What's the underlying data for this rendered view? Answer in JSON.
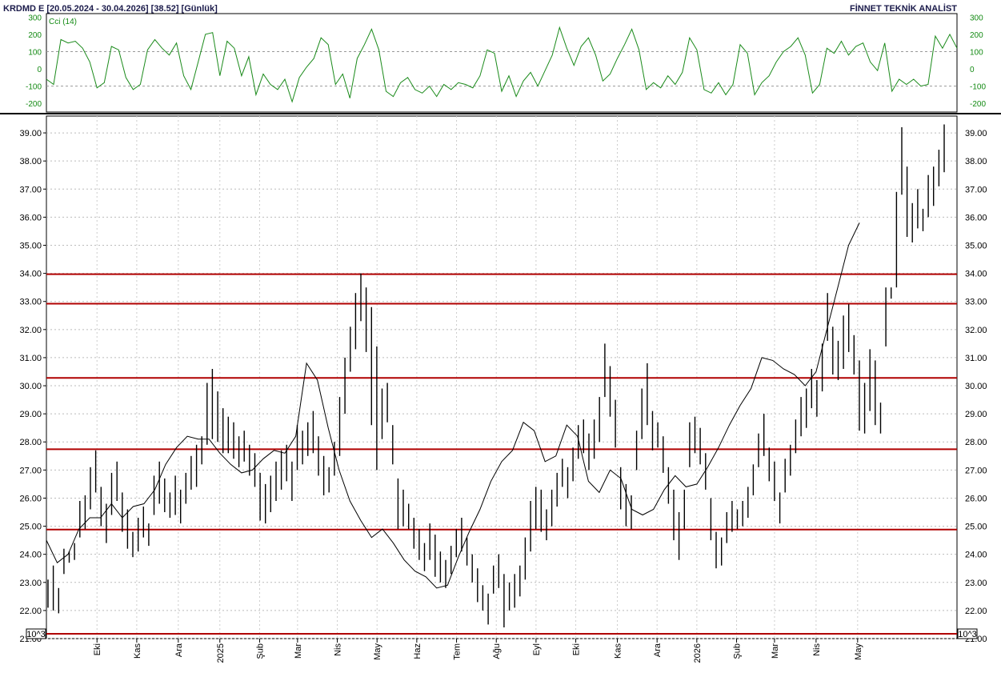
{
  "header": {
    "left_title": "KRDMD E  [20.05.2024 - 30.04.2026]  [38.52]  [Günlük]",
    "right_title": "FİNNET TEKNİK ANALİST"
  },
  "scale_note": "10^3",
  "chart_data": [
    {
      "type": "line",
      "name": "Cci (14)",
      "ylim": [
        -250,
        320
      ],
      "y_ticks": [
        "300",
        "200",
        "100",
        "0",
        "-100",
        "-200"
      ],
      "y_tick_values": [
        300,
        200,
        100,
        0,
        -100,
        -200
      ],
      "reference_lines": [
        100,
        -100
      ],
      "color": "#1a8a1a",
      "x": [
        0,
        4,
        8,
        12,
        16,
        20,
        24,
        28,
        32,
        36,
        40,
        44,
        48,
        52,
        56,
        60,
        64,
        68,
        72,
        76,
        80,
        84,
        88,
        92,
        96,
        100,
        104,
        108,
        112,
        116,
        120,
        124,
        128,
        132,
        136,
        140,
        144,
        148,
        152,
        156,
        160,
        164,
        168,
        172,
        176,
        180,
        184,
        188,
        192,
        196,
        200,
        204,
        208,
        212,
        216,
        220,
        224,
        228,
        232,
        236,
        240,
        244,
        248,
        252,
        256,
        260,
        264,
        268,
        272,
        276,
        280,
        284,
        288,
        292,
        296,
        300,
        304,
        308,
        312,
        316,
        320,
        324,
        328,
        332,
        336,
        340,
        344,
        348,
        352,
        356,
        360,
        364,
        368,
        372,
        376,
        380,
        384,
        388,
        392,
        396,
        400,
        404,
        408,
        412,
        416,
        420,
        424,
        428,
        432,
        436,
        440,
        444,
        448,
        452,
        456,
        460,
        464,
        468,
        472,
        476,
        480,
        484,
        488,
        492,
        496,
        500,
        504
      ],
      "values": [
        -60,
        -90,
        170,
        150,
        160,
        120,
        40,
        -110,
        -80,
        130,
        110,
        -50,
        -120,
        -90,
        110,
        170,
        120,
        80,
        150,
        -40,
        -120,
        40,
        200,
        210,
        -40,
        160,
        120,
        -40,
        70,
        -150,
        -30,
        -90,
        -120,
        -60,
        -190,
        -50,
        10,
        60,
        180,
        140,
        -90,
        -30,
        -170,
        60,
        140,
        230,
        110,
        -130,
        -160,
        -80,
        -50,
        -120,
        -140,
        -100,
        -160,
        -90,
        -120,
        -80,
        -90,
        -110,
        -40,
        110,
        90,
        -130,
        -40,
        -160,
        -70,
        -20,
        -100,
        -10,
        80,
        240,
        120,
        20,
        130,
        180,
        80,
        -70,
        -30,
        60,
        140,
        230,
        110,
        -120,
        -80,
        -110,
        -40,
        -90,
        -20,
        180,
        110,
        -120,
        -140,
        -80,
        -150,
        -90,
        140,
        90,
        -150,
        -80,
        -40,
        40,
        100,
        130,
        180,
        80,
        -140,
        -90,
        120,
        90,
        160,
        80,
        130,
        150,
        40,
        -10,
        150,
        -130,
        -60,
        -90,
        -60,
        -100,
        -90,
        190,
        120,
        200,
        120,
        80,
        60,
        90,
        210
      ],
      "x_domain": [
        0,
        504
      ]
    },
    {
      "type": "bar",
      "style": "ohlc_range_bars",
      "ylim": [
        21.0,
        39.6
      ],
      "y_ticks": [
        "39.00",
        "38.00",
        "37.00",
        "36.00",
        "35.00",
        "34.00",
        "33.00",
        "32.00",
        "31.00",
        "30.00",
        "29.00",
        "28.00",
        "27.00",
        "26.00",
        "25.00",
        "24.00",
        "23.00",
        "22.00",
        "21.00"
      ],
      "y_tick_values": [
        39,
        38,
        37,
        36,
        35,
        34,
        33,
        32,
        31,
        30,
        29,
        28,
        27,
        26,
        25,
        24,
        23,
        22,
        21
      ],
      "x_ticks": [
        "Eki",
        "Kas",
        "Ara",
        "2025",
        "Şub",
        "Mar",
        "Nis",
        "May",
        "Haz",
        "Tem",
        "Ağu",
        "Eyl",
        "Eki",
        "Kas",
        "Ara",
        "2026",
        "Şub",
        "Mar",
        "Nis",
        "May"
      ],
      "x_tick_positions": [
        28,
        50,
        73,
        96,
        118,
        139,
        161,
        183,
        205,
        227,
        249,
        271,
        293,
        316,
        338,
        360,
        382,
        403,
        426,
        449
      ],
      "x_domain": [
        0,
        504
      ],
      "horizontal_levels": [
        33.97,
        32.92,
        30.28,
        27.74,
        24.88,
        21.17
      ],
      "level_color": "#b00000",
      "moving_average": {
        "x": [
          0,
          6,
          12,
          18,
          24,
          30,
          36,
          42,
          48,
          54,
          60,
          66,
          72,
          78,
          84,
          90,
          96,
          102,
          108,
          114,
          120,
          126,
          132,
          138,
          144,
          150,
          156,
          162,
          168,
          174,
          180,
          186,
          192,
          198,
          204,
          210,
          216,
          222,
          228,
          234,
          240,
          246,
          252,
          258,
          264,
          270,
          276,
          282,
          288,
          294,
          300,
          306,
          312,
          318,
          324,
          330,
          336,
          342,
          348,
          354,
          360,
          366,
          372,
          378,
          384,
          390,
          396,
          402,
          408,
          414,
          420,
          426,
          432,
          438,
          444,
          450,
          456,
          462,
          468,
          474,
          480,
          486,
          492,
          496
        ],
        "values": [
          24.5,
          23.7,
          24.0,
          24.9,
          25.3,
          25.3,
          25.8,
          25.3,
          25.7,
          25.8,
          26.3,
          27.2,
          27.8,
          28.2,
          28.1,
          28.1,
          27.6,
          27.2,
          26.9,
          27.0,
          27.4,
          27.7,
          27.6,
          28.2,
          30.8,
          30.2,
          28.5,
          27.0,
          25.9,
          25.2,
          24.6,
          24.9,
          24.4,
          23.8,
          23.4,
          23.2,
          22.8,
          22.9,
          23.9,
          24.8,
          25.6,
          26.6,
          27.3,
          27.7,
          28.7,
          28.4,
          27.3,
          27.5,
          28.6,
          28.2,
          26.6,
          26.2,
          27.0,
          26.7,
          25.6,
          25.4,
          25.6,
          26.3,
          26.8,
          26.4,
          26.5,
          27.1,
          27.8,
          28.6,
          29.3,
          29.9,
          31.0,
          30.9,
          30.6,
          30.4,
          30.0,
          30.5,
          32.0,
          33.5,
          35.0,
          35.8
        ],
        "note": "30-day moving average"
      },
      "bars": [
        [
          0,
          23.1,
          22.1
        ],
        [
          1,
          23.6,
          22.0
        ],
        [
          2,
          22.8,
          21.9
        ],
        [
          3,
          24.2,
          23.3
        ],
        [
          4,
          24.1,
          23.7
        ],
        [
          5,
          24.4,
          23.8
        ],
        [
          6,
          25.9,
          24.6
        ],
        [
          7,
          26.1,
          24.9
        ],
        [
          8,
          27.1,
          25.6
        ],
        [
          9,
          27.7,
          26.2
        ],
        [
          10,
          26.4,
          25.0
        ],
        [
          11,
          25.8,
          24.4
        ],
        [
          12,
          26.9,
          25.4
        ],
        [
          13,
          27.3,
          25.9
        ],
        [
          14,
          26.2,
          24.8
        ],
        [
          15,
          25.6,
          24.2
        ],
        [
          16,
          24.8,
          23.9
        ],
        [
          17,
          25.3,
          24.1
        ],
        [
          18,
          25.7,
          24.6
        ],
        [
          19,
          25.1,
          24.3
        ],
        [
          20,
          26.8,
          25.4
        ],
        [
          21,
          27.3,
          25.8
        ],
        [
          22,
          26.7,
          25.5
        ],
        [
          23,
          26.2,
          25.3
        ],
        [
          24,
          26.8,
          25.4
        ],
        [
          25,
          26.3,
          25.1
        ],
        [
          26,
          26.9,
          25.8
        ],
        [
          27,
          27.5,
          26.3
        ],
        [
          28,
          27.9,
          26.4
        ],
        [
          29,
          28.2,
          27.2
        ],
        [
          30,
          30.1,
          27.9
        ],
        [
          31,
          30.6,
          28.1
        ],
        [
          32,
          29.8,
          28.0
        ],
        [
          33,
          29.2,
          27.6
        ],
        [
          34,
          28.9,
          27.6
        ],
        [
          35,
          28.7,
          27.4
        ],
        [
          36,
          28.2,
          27.1
        ],
        [
          37,
          28.4,
          27.3
        ],
        [
          38,
          27.9,
          26.8
        ],
        [
          39,
          27.6,
          26.4
        ],
        [
          40,
          26.9,
          25.2
        ],
        [
          41,
          26.5,
          25.1
        ],
        [
          42,
          26.8,
          25.5
        ],
        [
          43,
          27.3,
          25.9
        ],
        [
          44,
          27.7,
          26.3
        ],
        [
          45,
          27.9,
          26.6
        ],
        [
          46,
          27.3,
          25.9
        ],
        [
          47,
          28.6,
          27.0
        ],
        [
          48,
          28.4,
          27.2
        ],
        [
          49,
          28.7,
          27.5
        ],
        [
          50,
          29.1,
          27.6
        ],
        [
          51,
          28.2,
          26.8
        ],
        [
          52,
          27.5,
          26.1
        ],
        [
          53,
          27.1,
          26.2
        ],
        [
          54,
          28.0,
          26.8
        ],
        [
          55,
          29.6,
          27.5
        ],
        [
          56,
          31.0,
          29.0
        ],
        [
          57,
          32.1,
          30.5
        ],
        [
          58,
          33.3,
          31.3
        ],
        [
          59,
          34.0,
          32.3
        ],
        [
          60,
          33.5,
          31.2
        ],
        [
          61,
          32.8,
          28.6
        ],
        [
          62,
          31.4,
          27.0
        ],
        [
          63,
          29.9,
          28.1
        ],
        [
          64,
          30.1,
          28.7
        ],
        [
          65,
          28.6,
          27.2
        ],
        [
          66,
          26.7,
          24.9
        ],
        [
          67,
          26.3,
          25.0
        ],
        [
          68,
          25.8,
          24.9
        ],
        [
          69,
          25.3,
          24.2
        ],
        [
          70,
          24.9,
          23.8
        ],
        [
          71,
          24.4,
          23.4
        ],
        [
          72,
          25.1,
          23.8
        ],
        [
          73,
          24.7,
          23.2
        ],
        [
          74,
          24.1,
          23.0
        ],
        [
          75,
          23.8,
          22.8
        ],
        [
          76,
          24.3,
          23.3
        ],
        [
          77,
          24.9,
          23.9
        ],
        [
          78,
          25.3,
          24.1
        ],
        [
          79,
          24.6,
          23.6
        ],
        [
          80,
          24.0,
          23.0
        ],
        [
          81,
          23.5,
          22.3
        ],
        [
          82,
          22.9,
          22.0
        ],
        [
          83,
          22.6,
          21.5
        ],
        [
          84,
          23.6,
          22.6
        ],
        [
          85,
          24.0,
          22.8
        ],
        [
          86,
          23.3,
          21.4
        ],
        [
          87,
          23.0,
          22.0
        ],
        [
          88,
          23.3,
          22.1
        ],
        [
          89,
          23.6,
          22.5
        ],
        [
          90,
          24.6,
          23.1
        ],
        [
          91,
          25.9,
          24.1
        ],
        [
          92,
          26.4,
          24.9
        ],
        [
          93,
          26.3,
          24.8
        ],
        [
          94,
          25.6,
          24.5
        ],
        [
          95,
          26.3,
          25.0
        ],
        [
          96,
          26.9,
          25.7
        ],
        [
          97,
          27.4,
          26.4
        ],
        [
          98,
          27.1,
          26.0
        ],
        [
          99,
          27.8,
          26.6
        ],
        [
          100,
          28.6,
          27.4
        ],
        [
          101,
          28.8,
          27.6
        ],
        [
          102,
          28.3,
          27.0
        ],
        [
          103,
          28.8,
          27.4
        ],
        [
          104,
          29.6,
          28.0
        ],
        [
          105,
          31.5,
          29.6
        ],
        [
          106,
          30.7,
          28.9
        ],
        [
          107,
          29.5,
          27.8
        ],
        [
          108,
          27.1,
          25.6
        ],
        [
          109,
          26.5,
          25.0
        ],
        [
          110,
          26.1,
          24.9
        ],
        [
          111,
          28.4,
          27.0
        ],
        [
          112,
          29.9,
          28.1
        ],
        [
          113,
          30.8,
          28.6
        ],
        [
          114,
          29.1,
          27.7
        ],
        [
          115,
          28.7,
          27.8
        ],
        [
          116,
          28.2,
          26.9
        ],
        [
          117,
          27.1,
          25.8
        ],
        [
          118,
          26.3,
          24.5
        ],
        [
          119,
          25.5,
          23.8
        ],
        [
          120,
          26.3,
          24.9
        ],
        [
          121,
          28.7,
          27.1
        ],
        [
          122,
          28.9,
          27.6
        ],
        [
          123,
          28.5,
          27.2
        ],
        [
          124,
          27.6,
          26.3
        ],
        [
          125,
          26.0,
          24.5
        ],
        [
          126,
          24.8,
          23.5
        ],
        [
          127,
          24.6,
          23.6
        ],
        [
          128,
          25.5,
          24.4
        ],
        [
          129,
          25.9,
          24.8
        ],
        [
          130,
          25.6,
          24.9
        ],
        [
          131,
          25.9,
          25.0
        ],
        [
          132,
          26.4,
          25.3
        ],
        [
          133,
          27.2,
          26.1
        ],
        [
          134,
          28.3,
          27.1
        ],
        [
          135,
          29.0,
          27.5
        ],
        [
          136,
          27.8,
          26.6
        ],
        [
          137,
          27.3,
          25.9
        ],
        [
          138,
          26.2,
          25.1
        ],
        [
          139,
          27.4,
          26.2
        ],
        [
          140,
          27.9,
          26.8
        ],
        [
          141,
          28.8,
          27.6
        ],
        [
          142,
          29.6,
          28.2
        ],
        [
          143,
          29.9,
          28.5
        ],
        [
          144,
          30.6,
          29.2
        ],
        [
          145,
          30.2,
          28.9
        ],
        [
          146,
          31.5,
          29.8
        ],
        [
          147,
          33.3,
          31.6
        ],
        [
          148,
          32.1,
          30.4
        ],
        [
          149,
          31.6,
          30.2
        ],
        [
          150,
          32.5,
          30.6
        ],
        [
          151,
          32.9,
          31.2
        ],
        [
          152,
          31.8,
          30.4
        ],
        [
          153,
          30.9,
          28.4
        ],
        [
          154,
          30.1,
          28.3
        ],
        [
          155,
          31.3,
          29.1
        ],
        [
          156,
          30.9,
          28.6
        ],
        [
          157,
          29.4,
          28.3
        ],
        [
          158,
          33.5,
          31.4
        ],
        [
          159,
          33.5,
          33.1
        ],
        [
          160,
          36.9,
          33.5
        ],
        [
          161,
          39.2,
          36.8
        ],
        [
          162,
          37.8,
          35.3
        ],
        [
          163,
          36.5,
          35.1
        ],
        [
          164,
          37.0,
          35.6
        ],
        [
          165,
          36.3,
          35.5
        ],
        [
          166,
          37.5,
          36.0
        ],
        [
          167,
          37.8,
          36.4
        ],
        [
          168,
          38.4,
          37.1
        ],
        [
          169,
          39.3,
          37.6
        ]
      ],
      "bar_index_domain": [
        0,
        169
      ]
    }
  ]
}
